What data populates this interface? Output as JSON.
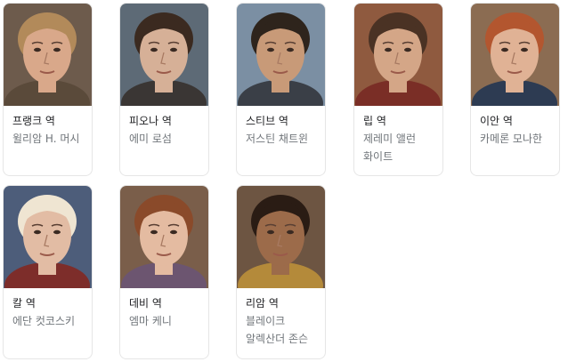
{
  "cast": [
    {
      "role": "프랭크 역",
      "actor": "윌리암 H. 머시",
      "photo": "frank-photo",
      "bg": "#6d5b4c",
      "skin": "#d9a88a",
      "hair": "#b28a5a",
      "shirt": "#5a4a3a"
    },
    {
      "role": "피오나 역",
      "actor": "에미 로섬",
      "photo": "fiona-photo",
      "bg": "#5d6a76",
      "skin": "#d6b097",
      "hair": "#3b2a20",
      "shirt": "#3a3634"
    },
    {
      "role": "스티브 역",
      "actor": "저스틴 채트윈",
      "photo": "steve-photo",
      "bg": "#7b8fa3",
      "skin": "#c89a78",
      "hair": "#2e241c",
      "shirt": "#3a3f47"
    },
    {
      "role": "립 역",
      "actor": "제레미 앨런 화이트",
      "photo": "lip-photo",
      "bg": "#8f5a3f",
      "skin": "#d4a687",
      "hair": "#4a3224",
      "shirt": "#7a2e26"
    },
    {
      "role": "이안 역",
      "actor": "카메론 모나한",
      "photo": "ian-photo",
      "bg": "#8b6c52",
      "skin": "#e0b295",
      "hair": "#b3562f",
      "shirt": "#2d3b52"
    },
    {
      "role": "칼 역",
      "actor": "에단 컷코스키",
      "photo": "carl-photo",
      "bg": "#4d5d7a",
      "skin": "#e2bca4",
      "hair": "#efe5d2",
      "shirt": "#7d2d2a"
    },
    {
      "role": "데비 역",
      "actor": "엠마 케니",
      "photo": "debbie-photo",
      "bg": "#7a5e4a",
      "skin": "#e4bba1",
      "hair": "#8a4a2a",
      "shirt": "#6c5570"
    },
    {
      "role": "리암 역",
      "actor": "블레이크 알렉산더 존슨",
      "photo": "liam-photo",
      "bg": "#6d5542",
      "skin": "#9c6b4a",
      "hair": "#2a1c14",
      "shirt": "#b48a3a"
    }
  ]
}
